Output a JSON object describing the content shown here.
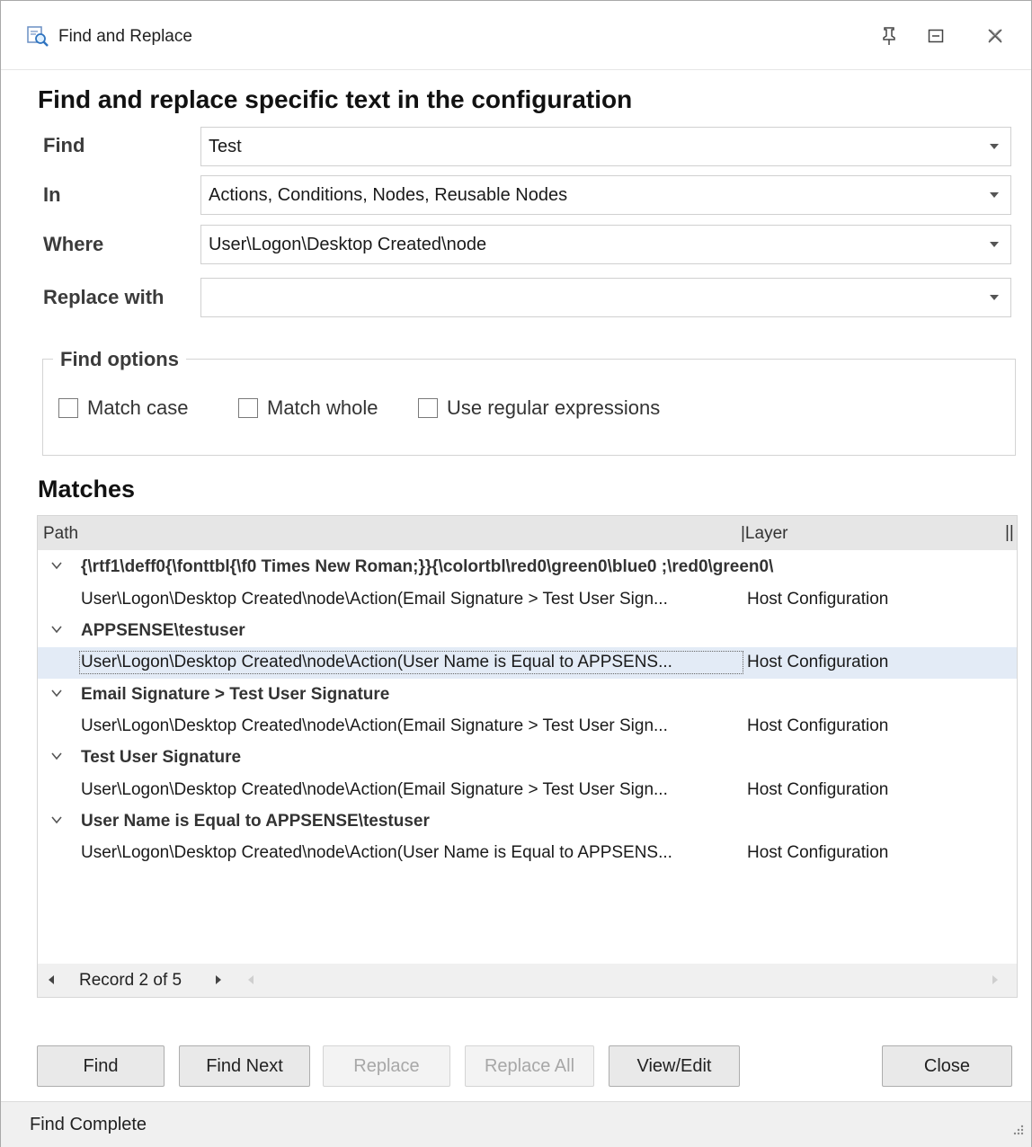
{
  "window": {
    "title": "Find and Replace"
  },
  "heading": "Find and replace specific text in the configuration",
  "form": {
    "find": {
      "label": "Find",
      "value": "Test"
    },
    "in": {
      "label": "In",
      "value": "Actions, Conditions, Nodes, Reusable Nodes"
    },
    "where": {
      "label": "Where",
      "value": "User\\Logon\\Desktop Created\\node"
    },
    "replace": {
      "label": "Replace with",
      "value": ""
    }
  },
  "find_options": {
    "legend": "Find options",
    "match_case": {
      "label": "Match case",
      "checked": false
    },
    "match_whole": {
      "label": "Match whole",
      "checked": false
    },
    "use_regex": {
      "label": "Use regular expressions",
      "checked": false
    }
  },
  "matches": {
    "title": "Matches",
    "columns": {
      "path": "Path",
      "layer": "|Layer",
      "end": "||"
    },
    "groups": [
      {
        "label": "{\\rtf1\\deff0{\\fonttbl{\\f0 Times New Roman;}}{\\colortbl\\red0\\green0\\blue0 ;\\red0\\green0\\",
        "row": {
          "path": "User\\Logon\\Desktop Created\\node\\Action(Email Signature > Test User Sign...",
          "layer": "Host Configuration"
        }
      },
      {
        "label": "APPSENSE\\testuser",
        "row": {
          "path": "User\\Logon\\Desktop Created\\node\\Action(User Name is Equal to APPSENS...",
          "layer": "Host Configuration"
        }
      },
      {
        "label": "Email Signature > Test User Signature",
        "row": {
          "path": "User\\Logon\\Desktop Created\\node\\Action(Email Signature > Test User Sign...",
          "layer": "Host Configuration"
        }
      },
      {
        "label": "Test User Signature",
        "row": {
          "path": "User\\Logon\\Desktop Created\\node\\Action(Email Signature > Test User Sign...",
          "layer": "Host Configuration"
        }
      },
      {
        "label": "User Name is Equal to APPSENSE\\testuser",
        "row": {
          "path": "User\\Logon\\Desktop Created\\node\\Action(User Name is Equal to APPSENS...",
          "layer": "Host Configuration"
        }
      }
    ],
    "selected_index": 1,
    "record_nav": "Record 2 of 5"
  },
  "buttons": {
    "find": "Find",
    "find_next": "Find Next",
    "replace": "Replace",
    "replace_all": "Replace All",
    "view_edit": "View/Edit",
    "close": "Close"
  },
  "status": "Find Complete",
  "colors": {
    "selection": "#e3ebf6",
    "header": "#e6e6e6",
    "disabled_text": "#a7a7a7"
  }
}
